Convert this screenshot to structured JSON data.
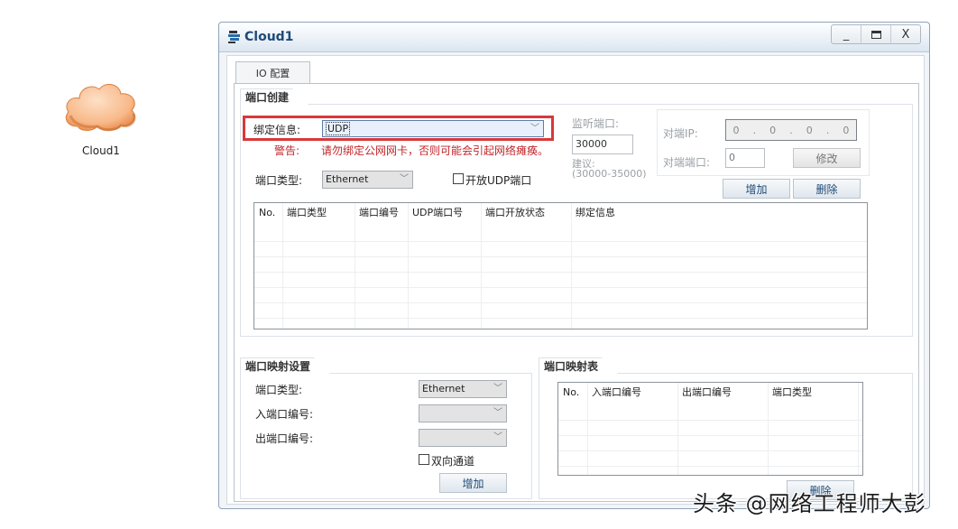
{
  "desktop": {
    "device_label": "Cloud1",
    "device_icon": "cloud-icon"
  },
  "window": {
    "title": "Cloud1",
    "controls": {
      "minimize": "_",
      "maximize": "☐",
      "close": "X"
    }
  },
  "tabs": [
    {
      "label": "IO 配置",
      "active": true
    }
  ],
  "port_create": {
    "title": "端口创建",
    "bind_info_label": "绑定信息:",
    "bind_info_value": "UDP",
    "warning_label": "警告:",
    "warning_text": "请勿绑定公网网卡，否则可能会引起网络瘫痪。",
    "port_type_label": "端口类型:",
    "port_type_value": "Ethernet",
    "open_udp_label": "开放UDP端口",
    "open_udp_checked": false,
    "listen_port_label": "监听端口:",
    "listen_port_value": "30000",
    "suggest_label": "建议:",
    "suggest_range": "(30000-35000)",
    "peer_ip_label": "对端IP:",
    "peer_ip_octets": [
      "0",
      "0",
      "0",
      "0"
    ],
    "peer_port_label": "对端端口:",
    "peer_port_value": "0",
    "modify_button": "修改",
    "add_button": "增加",
    "delete_button": "删除",
    "table": {
      "columns": [
        "No.",
        "端口类型",
        "端口编号",
        "UDP端口号",
        "端口开放状态",
        "绑定信息"
      ],
      "rows": []
    }
  },
  "port_mapping_settings": {
    "title": "端口映射设置",
    "port_type_label": "端口类型:",
    "port_type_value": "Ethernet",
    "in_port_label": "入端口编号:",
    "in_port_value": "",
    "out_port_label": "出端口编号:",
    "out_port_value": "",
    "bidirectional_label": "双向通道",
    "bidirectional_checked": false,
    "add_button": "增加"
  },
  "port_mapping_table": {
    "title": "端口映射表",
    "columns": [
      "No.",
      "入端口编号",
      "出端口编号",
      "端口类型"
    ],
    "rows": [],
    "delete_button": "删除"
  },
  "watermark": "头条 @网络工程师大彭",
  "colors": {
    "highlight_border": "#d9383a",
    "warning_text": "#c0262b",
    "title_text": "#1e4a78"
  }
}
